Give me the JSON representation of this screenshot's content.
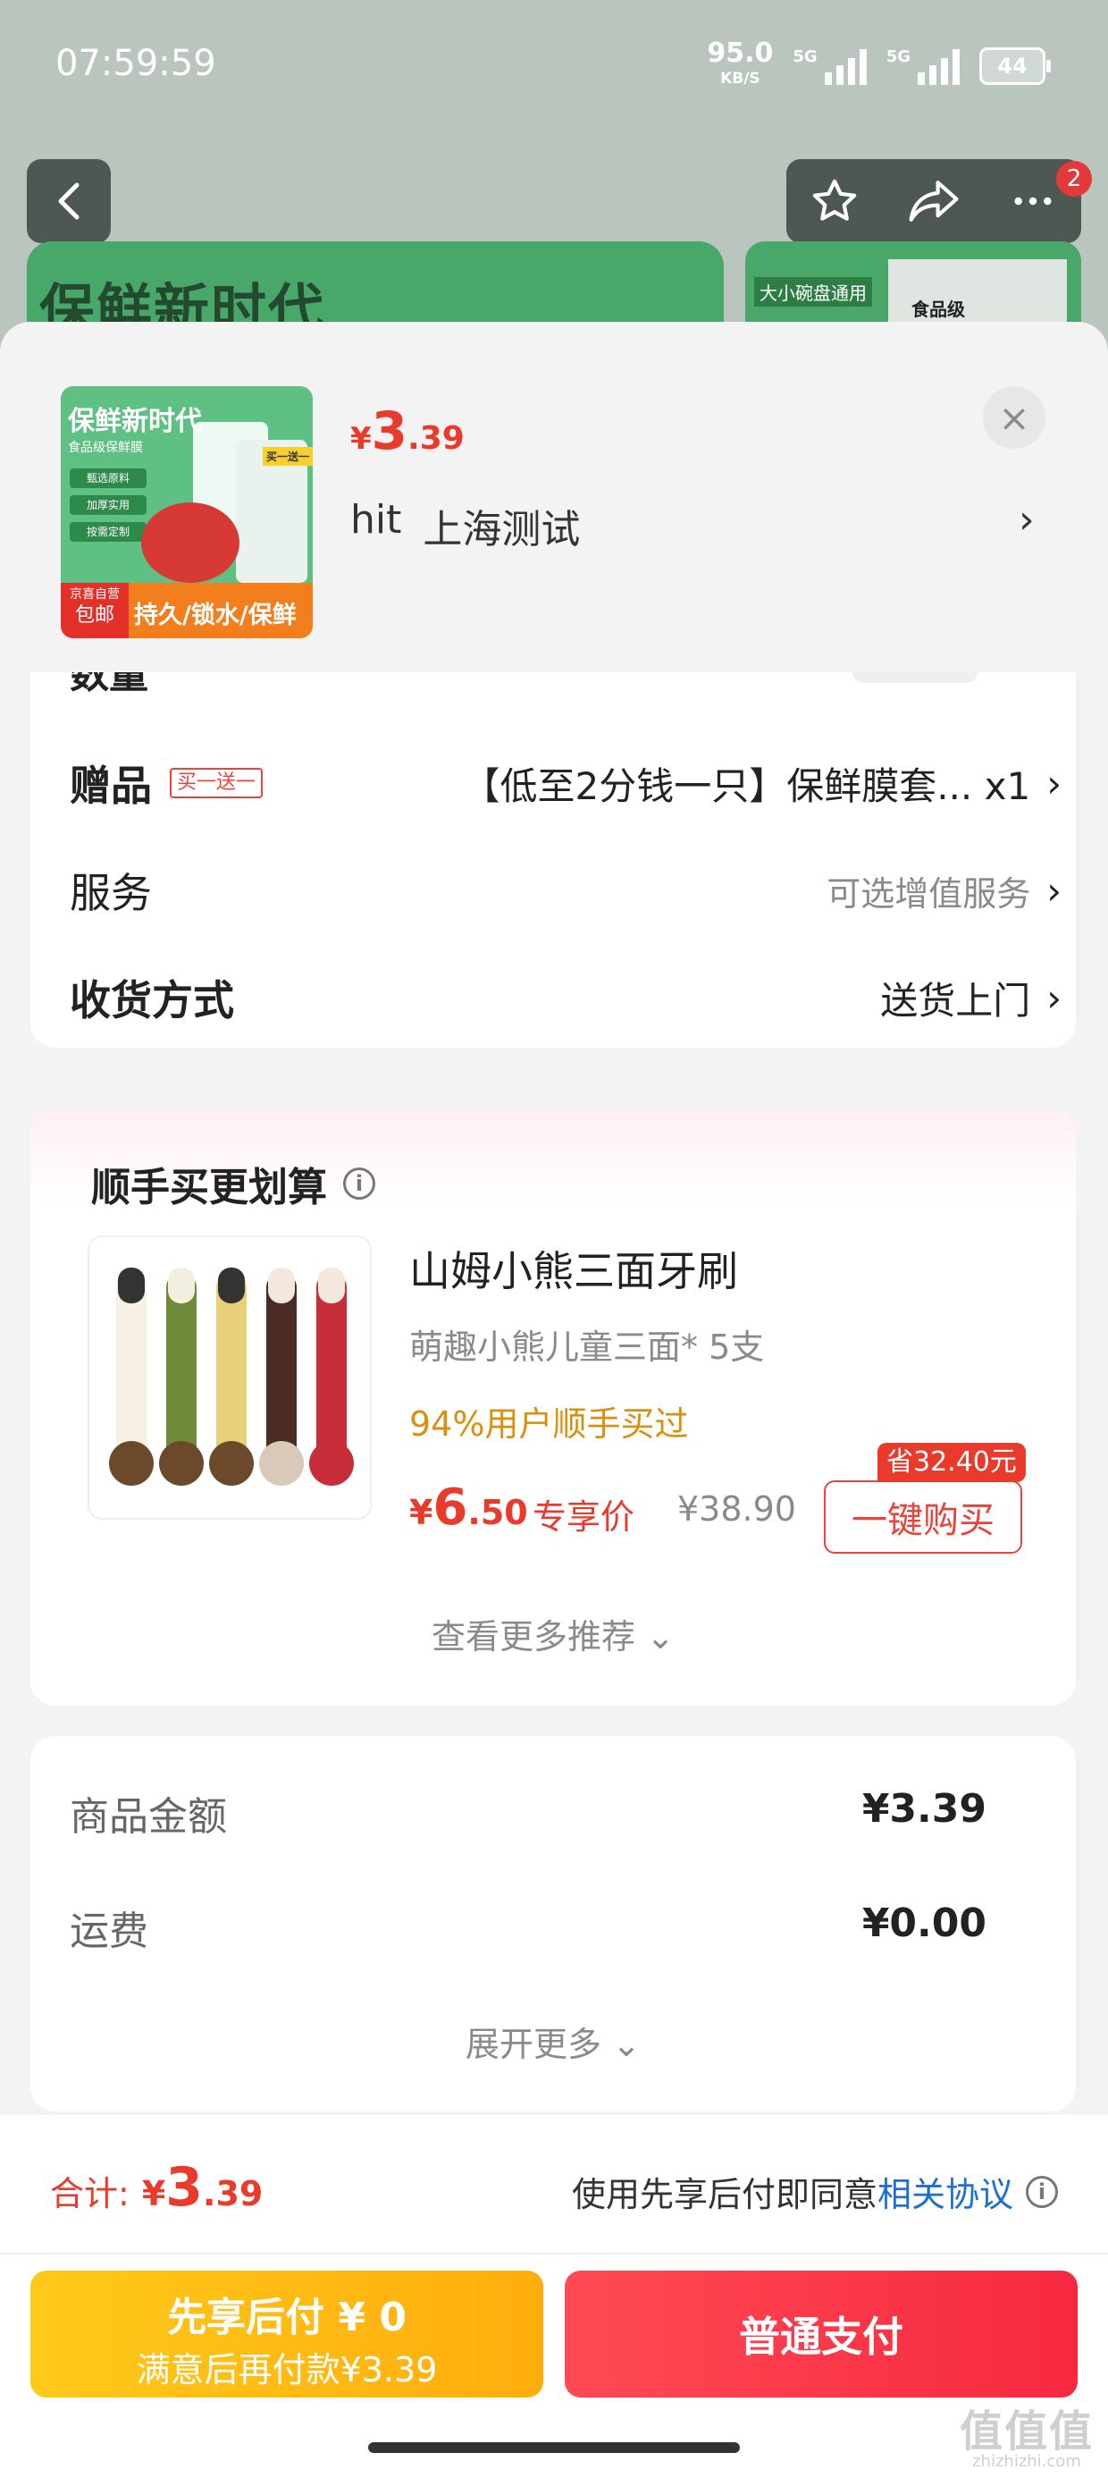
{
  "status_bar": {
    "time": "07:59:59",
    "net_speed": "95.0",
    "net_unit": "KB/S",
    "sig1_label": "5G",
    "sig2_label": "5G",
    "battery": "44"
  },
  "background": {
    "banner_title": "保鲜新时代",
    "thumb_label": "大小碗盘通用",
    "thumb_text": "食品级",
    "cart_count": "2"
  },
  "sheet": {
    "product": {
      "thumb_title": "保鲜新时代",
      "thumb_sub": "食品级保鲜膜",
      "thumb_chips": [
        "甄选原料",
        "加厚实用",
        "按需定制"
      ],
      "thumb_tag": "买一送一",
      "thumb_badge": "京喜自营",
      "thumb_badge2": "包邮",
      "thumb_strip": "持久/锁水/保鲜",
      "price_currency": "¥",
      "price_int": "3",
      "price_dec": ".39",
      "address_name": "hit",
      "address_city": "上海测试",
      "address_chevron": "›",
      "close_icon": "×"
    },
    "options": {
      "qty_label": "数量",
      "gift_label": "赠品",
      "gift_tag": "买一送一",
      "gift_value": "【低至2分钱一只】保鲜膜套... x1",
      "service_label": "服务",
      "service_value": "可选增值服务",
      "delivery_label": "收货方式",
      "delivery_value": "送货上门",
      "chevron": "›"
    },
    "recommend": {
      "title": "顺手买更划算",
      "info_icon": "i",
      "name": "山姆小熊三面牙刷",
      "sub": "萌趣小熊儿童三面* 5支",
      "pct": "94%用户顺手买过",
      "price_currency": "¥",
      "price_int": "6",
      "price_dec": ".50",
      "exclusive": "专享价",
      "orig_price": "¥38.90",
      "save_badge": "省32.40元",
      "buy_button": "一键购买",
      "more": "查看更多推荐 ⌄"
    },
    "summary": {
      "goods_label": "商品金额",
      "goods_value": "¥3.39",
      "shipping_label": "运费",
      "shipping_value": "¥0.00",
      "expand": "展开更多 ⌄"
    },
    "footer": {
      "total_label": "合计:",
      "total_currency": "¥",
      "total_int": "3",
      "total_dec": ".39",
      "agree_text": "使用先享后付即同意",
      "agree_link": "相关协议",
      "info_icon": "i",
      "later_line1": "先享后付 ¥ 0",
      "later_line2": "满意后再付款¥3.39",
      "pay_button": "普通支付",
      "watermark": "值值值",
      "watermark_sub": "zhizhizhi.com"
    }
  },
  "colors": {
    "accent_red": "#e93a2c",
    "link_blue": "#1e6fd1",
    "later_yellow": "#ffb80f",
    "pay_red": "#f6283f",
    "highlight_orange": "#d9900f"
  }
}
